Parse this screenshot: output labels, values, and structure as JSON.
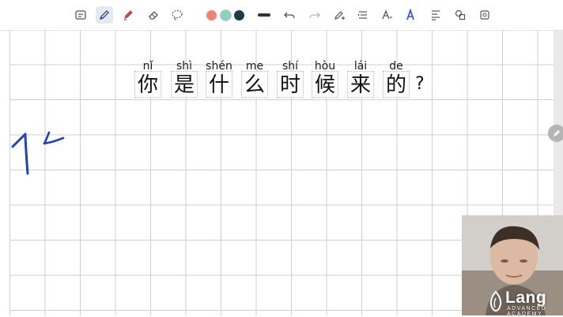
{
  "toolbar": {
    "tools": [
      "text-box-icon",
      "pen-icon",
      "highlighter-icon",
      "eraser-icon",
      "lasso-icon"
    ],
    "colors": [
      "#f08472",
      "#8fcfbf",
      "#1f3a48"
    ],
    "actions": [
      "undo-icon",
      "redo-icon",
      "pen-settings-icon",
      "shapes-icon",
      "text-icon",
      "ai-text-icon",
      "align-icon",
      "shape-recognition-icon",
      "insert-icon"
    ]
  },
  "sentence": {
    "pinyin": [
      "nǐ",
      "shì",
      "shén",
      "me",
      "shí",
      "hòu",
      "lái",
      "de"
    ],
    "hanzi": [
      "你",
      "是",
      "什",
      "么",
      "时",
      "候",
      "来",
      "的"
    ],
    "punct": "?"
  },
  "ink_color": "#1f44b5",
  "watermark": {
    "brand": "Lang",
    "sub": "ADVANCED ACADEMY"
  }
}
